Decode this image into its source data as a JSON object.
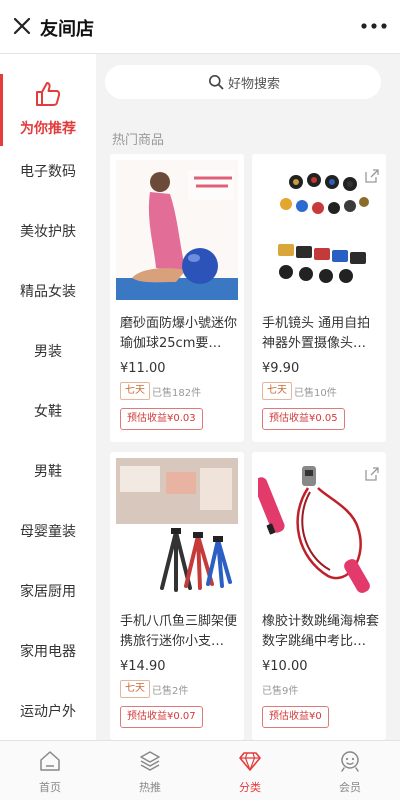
{
  "header": {
    "title": "友间店"
  },
  "sidebar": {
    "active": "为你推荐",
    "items": [
      "电子数码",
      "美妆护肤",
      "精品女装",
      "男装",
      "女鞋",
      "男鞋",
      "母婴童装",
      "家居厨用",
      "家用电器",
      "运动户外"
    ]
  },
  "search": {
    "placeholder": "好物搜索"
  },
  "section": {
    "label": "热门商品"
  },
  "products": [
    {
      "name": "磨砂面防爆小號迷你瑜伽球25cm要…",
      "price": "¥11.00",
      "tag": "七天",
      "sold": "已售182件",
      "earn": "预估收益¥0.03"
    },
    {
      "name": "手机镜头 通用自拍神器外置摄像头…",
      "price": "¥9.90",
      "tag": "七天",
      "sold": "已售10件",
      "earn": "预估收益¥0.05"
    },
    {
      "name": "手机八爪鱼三脚架便携旅行迷你小支…",
      "price": "¥14.90",
      "tag": "七天",
      "sold": "已售2件",
      "earn": "预估收益¥0.07"
    },
    {
      "name": "橡胶计数跳绳海棉套数字跳绳中考比…",
      "price": "¥10.00",
      "sold": "已售9件",
      "earn": "预估收益¥0"
    }
  ],
  "tabs": [
    "首页",
    "热推",
    "分类",
    "会员"
  ],
  "colors": {
    "accent": "#e33c3c",
    "tag": "#c96a38"
  }
}
